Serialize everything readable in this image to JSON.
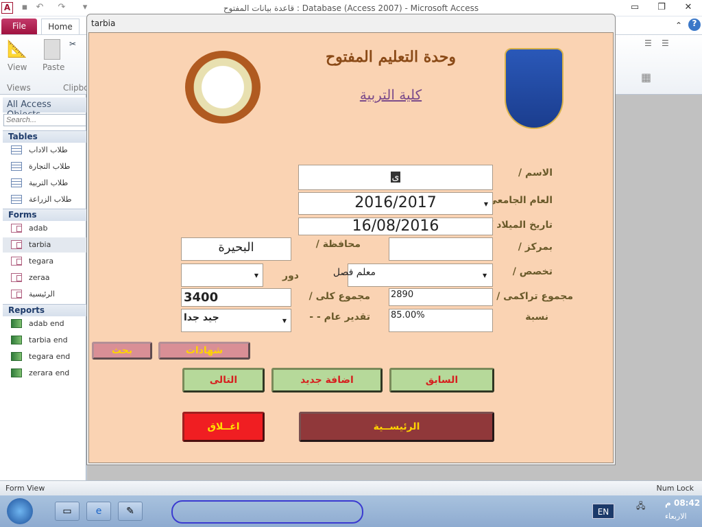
{
  "app": {
    "title": "قاعدة بيانات المفتوح : Database (Access 2007) - Microsoft Access",
    "icon": "access-icon"
  },
  "window_controls": {
    "minimize": "minimize-icon",
    "restore": "restore-icon",
    "close": "close-icon"
  },
  "ribbon": {
    "tabs": [
      "File",
      "Home"
    ],
    "groups": {
      "views": "Views",
      "clipboard": "Clipbo"
    },
    "buttons": {
      "view": "View",
      "paste": "Paste"
    }
  },
  "nav": {
    "header": "All Access Objects",
    "search_placeholder": "Search...",
    "tables_label": "Tables",
    "tables": [
      "طلاب الاداب",
      "طلاب التجارة",
      "طلاب التربية",
      "طلاب الزراعة"
    ],
    "forms_label": "Forms",
    "forms": [
      "adab",
      "tarbia",
      "tegara",
      "zeraa",
      "الرئيسية"
    ],
    "reports_label": "Reports",
    "reports": [
      "adab end",
      "tarbia end",
      "tegara end",
      "zerara end"
    ],
    "selected": "tarbia"
  },
  "form": {
    "window_title": "tarbia",
    "heading": "وحدة التعليم المفتوح",
    "subheading": "كلية التربية",
    "labels": {
      "name": "الاسم /",
      "year": "العام الجامعى",
      "birth": "تاريخ الميلاد /",
      "center": "بمركز /",
      "governorate": "محافظة /",
      "specialty": "تخصص /",
      "round": "دور",
      "cumulative": "مجموع تراكمى /",
      "total": "مجموع كلى /",
      "percent": "نسبة",
      "grade": "تقدير عام - -"
    },
    "values": {
      "name": "ى",
      "year": "2016/2017",
      "birth": "16/08/2016",
      "center": "",
      "governorate": "البحيرة",
      "specialty": "معلم فصل",
      "round": "",
      "cumulative": "2890",
      "total": "3400",
      "percent": "85.00%",
      "grade": "جيد جدا"
    },
    "buttons": {
      "search": "بحث",
      "certificates": "شهادات",
      "next": "التالى",
      "add_new": "اضافة جديد",
      "previous": "السابق",
      "close": "اغــلاق",
      "home": "الرئيســية"
    },
    "colors": {
      "background": "#fad3b3",
      "heading": "#8a4a17"
    }
  },
  "status": {
    "left": "Form View",
    "right": "Num Lock"
  },
  "taskbar": {
    "language": "EN",
    "time": "08:42 م",
    "day": "الاربعاء"
  }
}
